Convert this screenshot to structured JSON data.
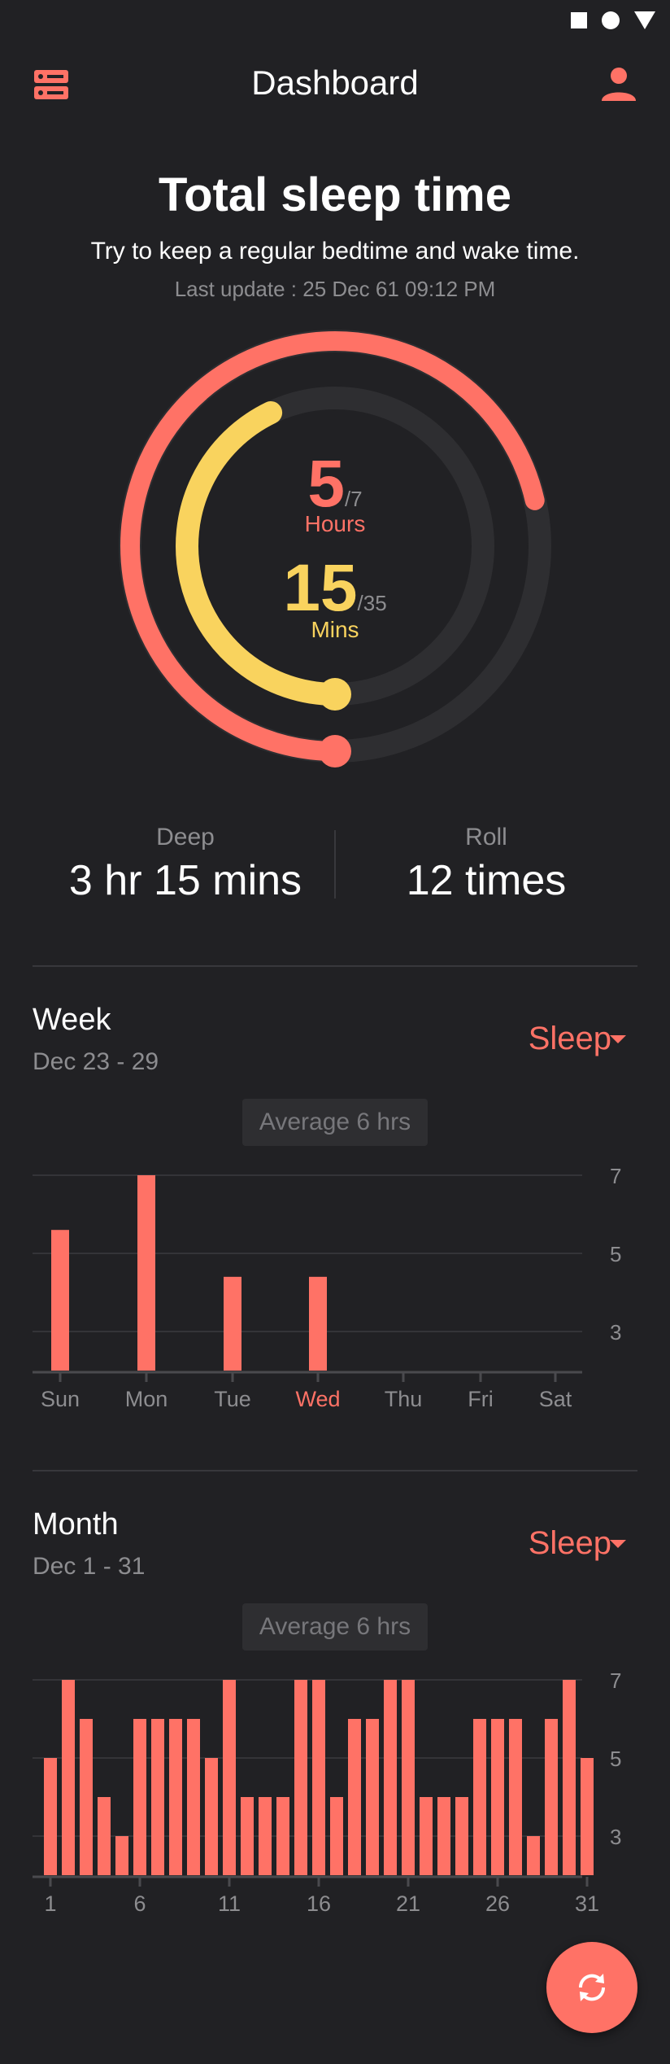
{
  "status_icons": [
    "square-icon",
    "circle-icon",
    "triangle-icon"
  ],
  "appbar": {
    "title": "Dashboard",
    "menu_icon": "server-icon",
    "user_icon": "person-icon"
  },
  "summary": {
    "title": "Total sleep time",
    "subtitle": "Try to keep a regular bedtime and wake time.",
    "last_update": "Last update : 25 Dec 61 09:12 PM"
  },
  "ring": {
    "hours_value": "5",
    "hours_total": "/7",
    "hours_label": "Hours",
    "hours_fraction": 0.7143,
    "mins_value": "15",
    "mins_total": "/35",
    "mins_label": "Mins",
    "mins_fraction": 0.4286,
    "colors": {
      "hours": "#ff7266",
      "mins": "#f9d35e",
      "track": "#2e2e31"
    }
  },
  "stats": {
    "deep_label": "Deep",
    "deep_value": "3 hr 15 mins",
    "roll_label": "Roll",
    "roll_value": "12 times"
  },
  "week": {
    "title": "Week",
    "range": "Dec 23 - 29",
    "selector": "Sleep",
    "average": "Average 6 hrs"
  },
  "month": {
    "title": "Month",
    "range": "Dec 1 - 31",
    "selector": "Sleep",
    "average": "Average 6 hrs"
  },
  "fab_icon": "sync-icon",
  "chart_data": [
    {
      "type": "bar",
      "categories": [
        "Sun",
        "Mon",
        "Tue",
        "Wed",
        "Thu",
        "Fri",
        "Sat"
      ],
      "values": [
        5.6,
        7,
        4.4,
        4.4,
        null,
        null,
        null
      ],
      "highlight_category": "Wed",
      "y_ticks": [
        "7",
        "5",
        "3"
      ],
      "ylim": [
        2,
        7
      ],
      "grid": true,
      "color": "#ff7266"
    },
    {
      "type": "bar",
      "categories": [
        "1",
        "2",
        "3",
        "4",
        "5",
        "6",
        "7",
        "8",
        "9",
        "10",
        "11",
        "12",
        "13",
        "14",
        "15",
        "16",
        "17",
        "18",
        "19",
        "20",
        "21",
        "22",
        "23",
        "24",
        "25",
        "26",
        "27",
        "28",
        "29",
        "30",
        "31"
      ],
      "tick_labels": [
        "1",
        "6",
        "11",
        "16",
        "21",
        "26",
        "31"
      ],
      "values": [
        5,
        7,
        6,
        4,
        3,
        6,
        6,
        6,
        6,
        5,
        7,
        4,
        4,
        4,
        7,
        7,
        4,
        6,
        6,
        7,
        7,
        4,
        4,
        4,
        6,
        6,
        6,
        3,
        6,
        7,
        5
      ],
      "y_ticks": [
        "7",
        "5",
        "3"
      ],
      "ylim": [
        2,
        7
      ],
      "grid": true,
      "color": "#ff7266"
    }
  ]
}
